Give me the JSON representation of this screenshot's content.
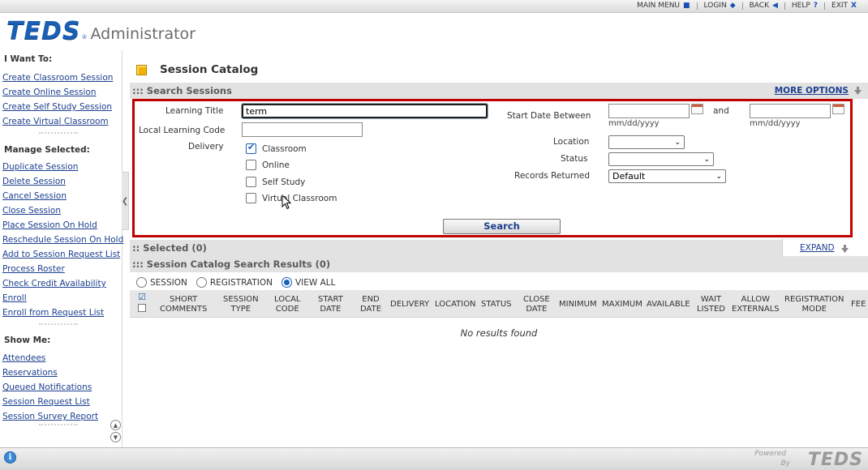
{
  "topnav": {
    "main_menu": "MAIN MENU",
    "login": "LOGIN",
    "back": "BACK",
    "help": "HELP",
    "help_icon": "?",
    "exit": "EXIT",
    "exit_icon": "X"
  },
  "header": {
    "logo": "TEDS",
    "logo_reg": "®",
    "app_title": "Administrator"
  },
  "sidebar": {
    "i_want_to": {
      "heading": "I Want To:",
      "items": [
        "Create Classroom Session",
        "Create Online Session",
        "Create Self Study Session",
        "Create Virtual Classroom"
      ]
    },
    "manage_selected": {
      "heading": "Manage Selected:",
      "items": [
        "Duplicate Session",
        "Delete Session",
        "Cancel Session",
        "Close Session",
        "Place Session On Hold",
        "Reschedule Session On Hold",
        "Add to Session Request List",
        "Process Roster",
        "Check Credit Availability",
        "Enroll",
        "Enroll from Request List"
      ]
    },
    "show_me": {
      "heading": "Show Me:",
      "items": [
        "Attendees",
        "Reservations",
        "Queued Notifications",
        "Session Request List",
        "Session Survey Report"
      ]
    }
  },
  "page": {
    "title": "Session Catalog"
  },
  "search_sessions": {
    "bar_title": "::: Search Sessions",
    "more_options": "MORE OPTIONS",
    "learning_title_label": "Learning Title",
    "learning_title_value": "term",
    "local_code_label": "Local Learning Code",
    "local_code_value": "",
    "delivery_label": "Delivery",
    "delivery_options": [
      {
        "label": "Classroom",
        "checked": true
      },
      {
        "label": "Online",
        "checked": false
      },
      {
        "label": "Self Study",
        "checked": false
      },
      {
        "label": "Virtual Classroom",
        "checked": false
      }
    ],
    "start_date_label": "Start Date Between",
    "and_label": "and",
    "date_hint": "mm/dd/yyyy",
    "date_from": "",
    "date_to": "",
    "location_label": "Location",
    "location_value": "",
    "status_label": "Status",
    "status_value": "",
    "records_label": "Records Returned",
    "records_value": "Default",
    "search_button": "Search"
  },
  "selected": {
    "bar_title": ":: Selected (0)",
    "expand": "EXPAND"
  },
  "results": {
    "bar_title": "::: Session Catalog Search Results (0)",
    "view_options": [
      {
        "label": "SESSION",
        "selected": false
      },
      {
        "label": "REGISTRATION",
        "selected": false
      },
      {
        "label": "VIEW ALL",
        "selected": true
      }
    ],
    "columns": [
      [
        "SHORT",
        "COMMENTS"
      ],
      [
        "SESSION",
        "TYPE"
      ],
      [
        "LOCAL",
        "CODE"
      ],
      [
        "START",
        "DATE"
      ],
      [
        "END",
        "DATE"
      ],
      [
        "DELIVERY"
      ],
      [
        "LOCATION"
      ],
      [
        "STATUS"
      ],
      [
        "CLOSE",
        "DATE"
      ],
      [
        "MINIMUM"
      ],
      [
        "MAXIMUM"
      ],
      [
        "AVAILABLE"
      ],
      [
        "WAIT",
        "LISTED"
      ],
      [
        "ALLOW",
        "EXTERNALS"
      ],
      [
        "REGISTRATION",
        "MODE"
      ],
      [
        "FEE"
      ]
    ],
    "empty_message": "No results found"
  },
  "footer": {
    "powered": "Powered",
    "by": "By",
    "logo": "TEDS"
  },
  "colors": {
    "accent_blue": "#1a5fb4",
    "link_blue": "#1b3f8f",
    "highlight_red": "#c00000",
    "bar_gray": "#e2e2e2"
  }
}
